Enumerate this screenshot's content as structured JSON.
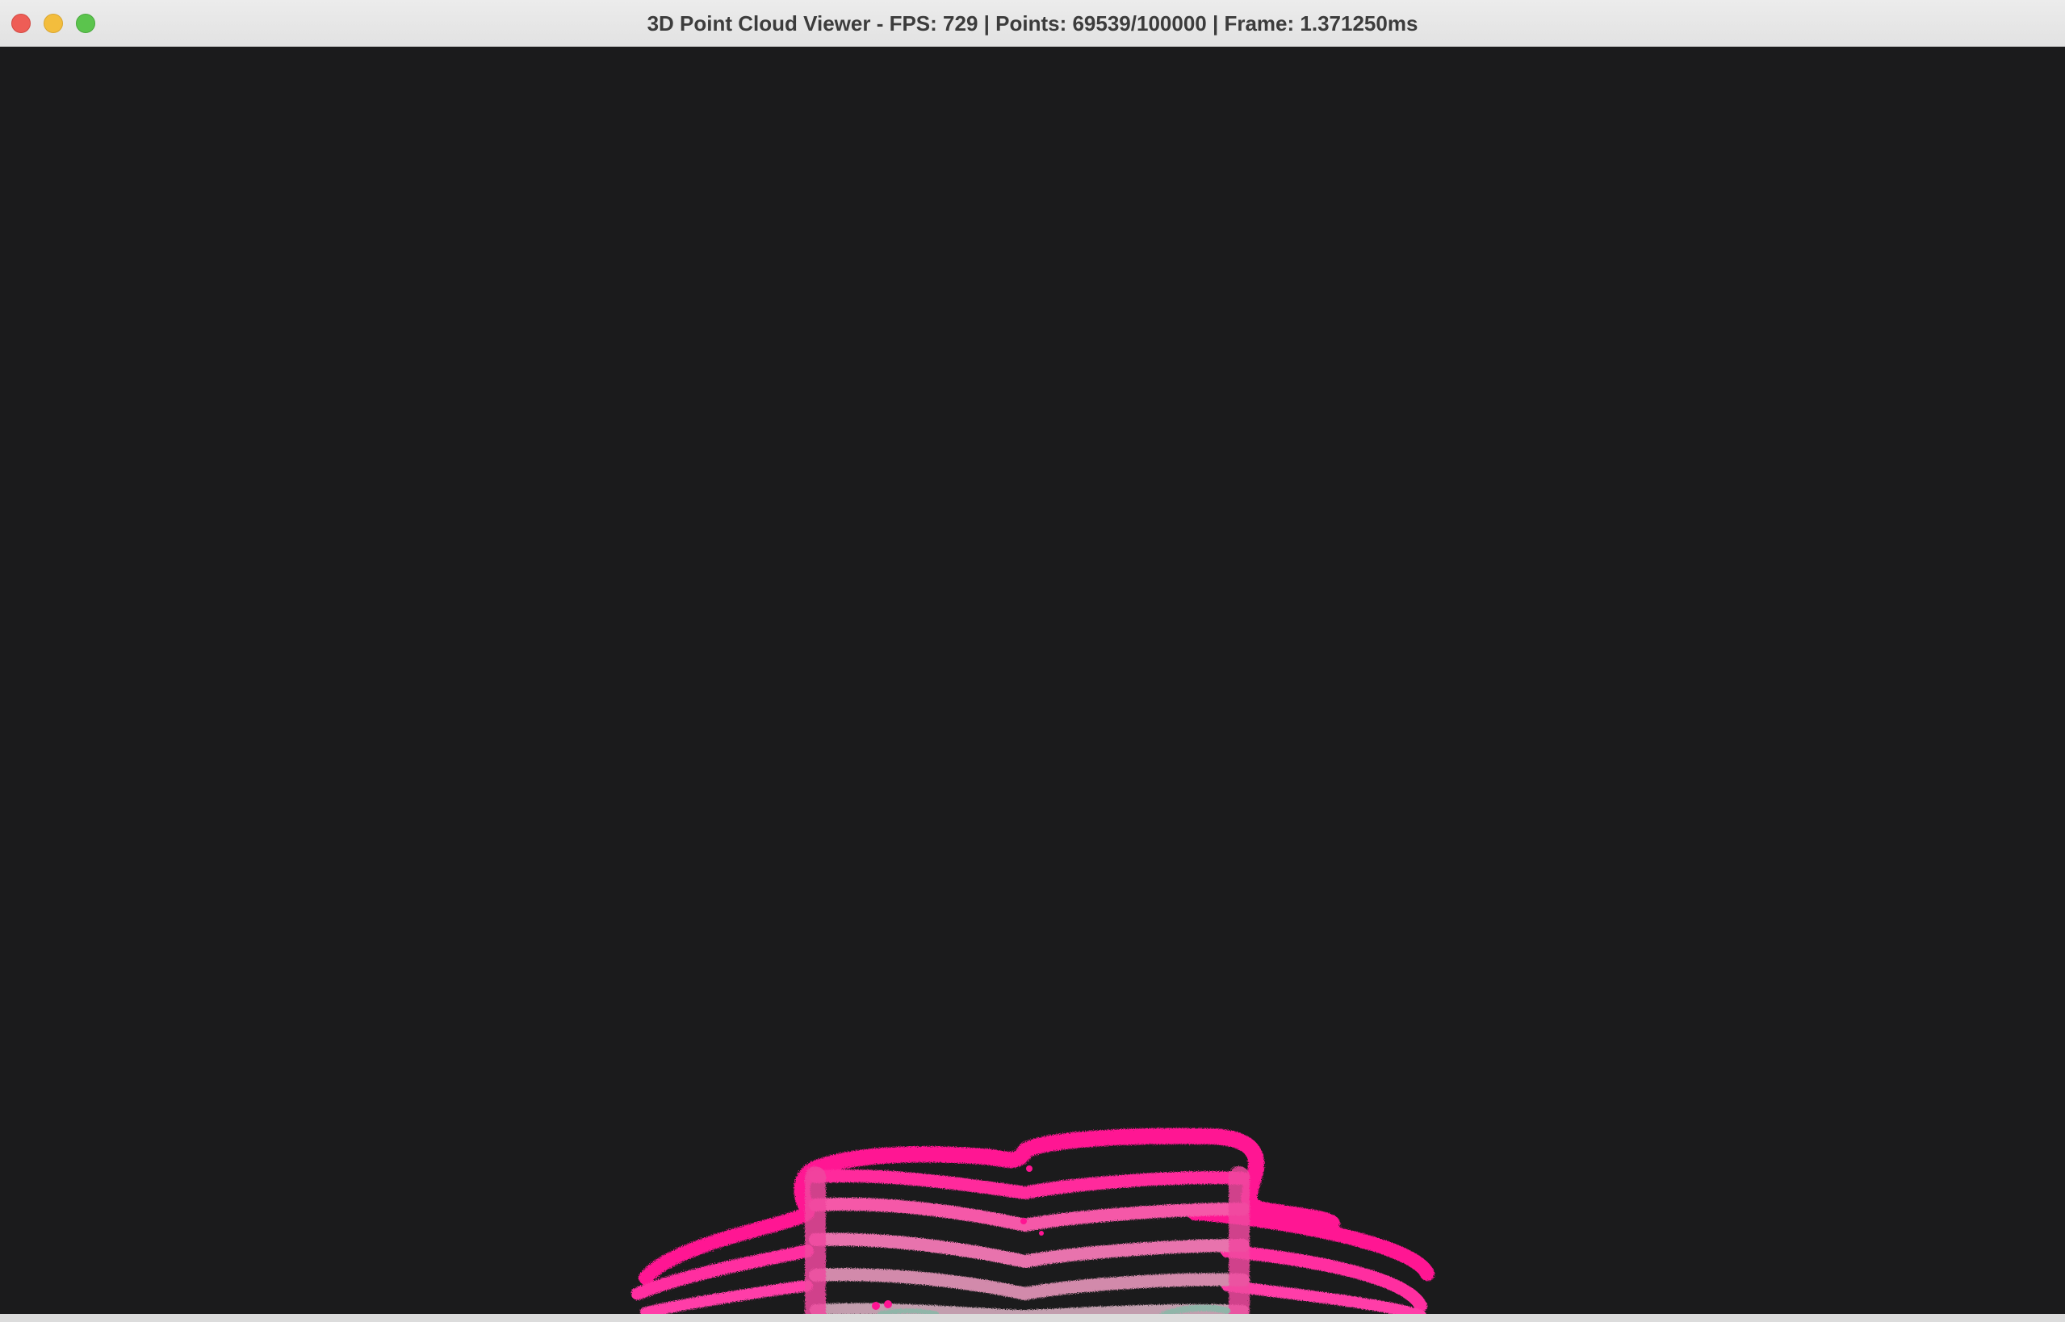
{
  "window": {
    "title": "3D Point Cloud Viewer - FPS: 729 | Points: 69539/100000 | Frame: 1.371250ms",
    "stats": {
      "fps": 729,
      "points_visible": 69539,
      "points_total": 100000,
      "frame_ms": 1.37125
    }
  },
  "scene": {
    "background_color": "#1b1b1c",
    "point_colors": {
      "primary": "#ff1493",
      "mid": "#f05fa6",
      "lower": "#c98aa8",
      "base": "#8fb5a8"
    }
  },
  "icons": {
    "close": "close-icon",
    "minimize": "minimize-icon",
    "zoom": "zoom-icon"
  }
}
